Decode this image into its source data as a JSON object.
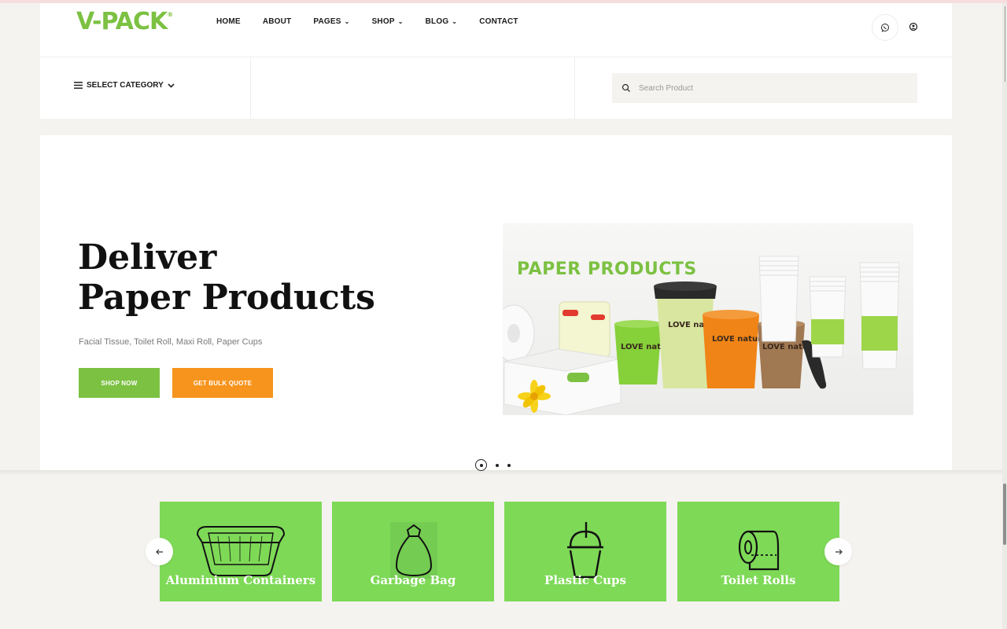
{
  "brand": {
    "logo_text": "V-PACK",
    "logo_mark": "®",
    "accent": "#7cc142",
    "orange": "#f7941d",
    "card_green": "#7ed957"
  },
  "nav": {
    "items": [
      {
        "label": "HOME",
        "has_dropdown": false
      },
      {
        "label": "ABOUT",
        "has_dropdown": false
      },
      {
        "label": "PAGES",
        "has_dropdown": true
      },
      {
        "label": "SHOP",
        "has_dropdown": true
      },
      {
        "label": "BLOG",
        "has_dropdown": true
      },
      {
        "label": "CONTACT",
        "has_dropdown": false
      }
    ],
    "icons": [
      "whatsapp-icon",
      "user-icon"
    ]
  },
  "toolbar": {
    "category_label": "SELECT CATEGORY",
    "search_placeholder": "Search Product"
  },
  "hero": {
    "title_line1": "Deliver",
    "title_line2": "Paper Products",
    "subtitle": "Facial Tissue, Toilet Roll, Maxi Roll, Paper Cups",
    "primary_button": "SHOP NOW",
    "secondary_button": "GET BULK QUOTE",
    "image_label": "PAPER PRODUCTS",
    "cup_texts": [
      "LOVE nature",
      "LOVE nature",
      "LOVE nature",
      "LOVE nature"
    ],
    "slides": {
      "total": 3,
      "active": 1
    }
  },
  "categories": {
    "items": [
      {
        "label": "Aluminium Containers",
        "icon": "container-tray-icon"
      },
      {
        "label": "Garbage Bag",
        "icon": "garbage-bag-icon"
      },
      {
        "label": "Plastic Cups",
        "icon": "plastic-cup-icon"
      },
      {
        "label": "Toilet Rolls",
        "icon": "toilet-roll-icon"
      }
    ],
    "prev_icon": "arrow-left-icon",
    "next_icon": "arrow-right-icon"
  }
}
